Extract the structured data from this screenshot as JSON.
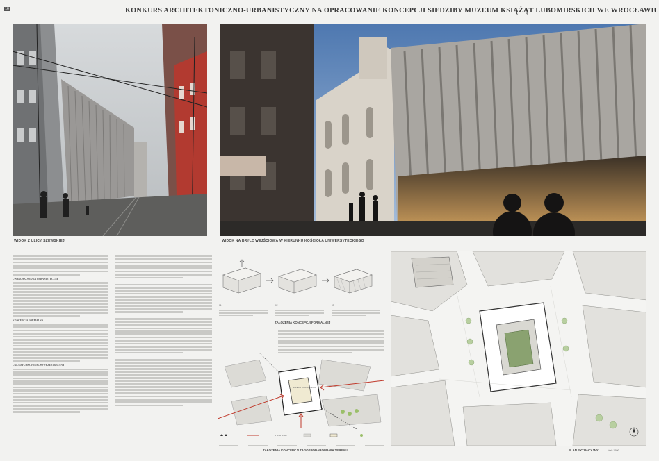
{
  "page": {
    "number": "16",
    "title": "KONKURS ARCHITEKTONICZNO-URBANISTYCZNY NA OPRACOWANIE KONCEPCJI SIEDZIBY MUZEUM KSIĄŻĄT LUBOMIRSKICH WE WROCŁAWIU"
  },
  "captions": {
    "street_view": "WIDOK Z ULICY SZEWSKIEJ",
    "church_view": "WIDOK NA BRYŁĘ WEJŚCIOWĄ W KIERUNKU KOŚCIOŁA UNIWERSYTECKIEGO",
    "formal_concept": "ZAŁOŻENIA KONCEPCJI FORMALNEJ",
    "site_concept": "ZAŁOŻENIA KONCEPCJI ZAGOSPODAROWANIA TERENU",
    "site_plan": "PLAN SYTUACYJNY",
    "site_plan_scale": "skala 1:500"
  },
  "text_sections": {
    "s1": "UWARUNKOWANIA URBANISTYCZNE",
    "s2": "KONCEPCJA FORMALNA",
    "s3": "UKŁAD FUNKCJONALNO-PRZESTRZENNY"
  },
  "diagram_labels": {
    "step1": "01",
    "step2": "02",
    "step3": "03",
    "block_label": "MUZEUM LUBOMIRSKICH"
  },
  "colors": {
    "sheet": "#f2f2f0",
    "text": "#333333",
    "accent_red": "#c0392b"
  }
}
